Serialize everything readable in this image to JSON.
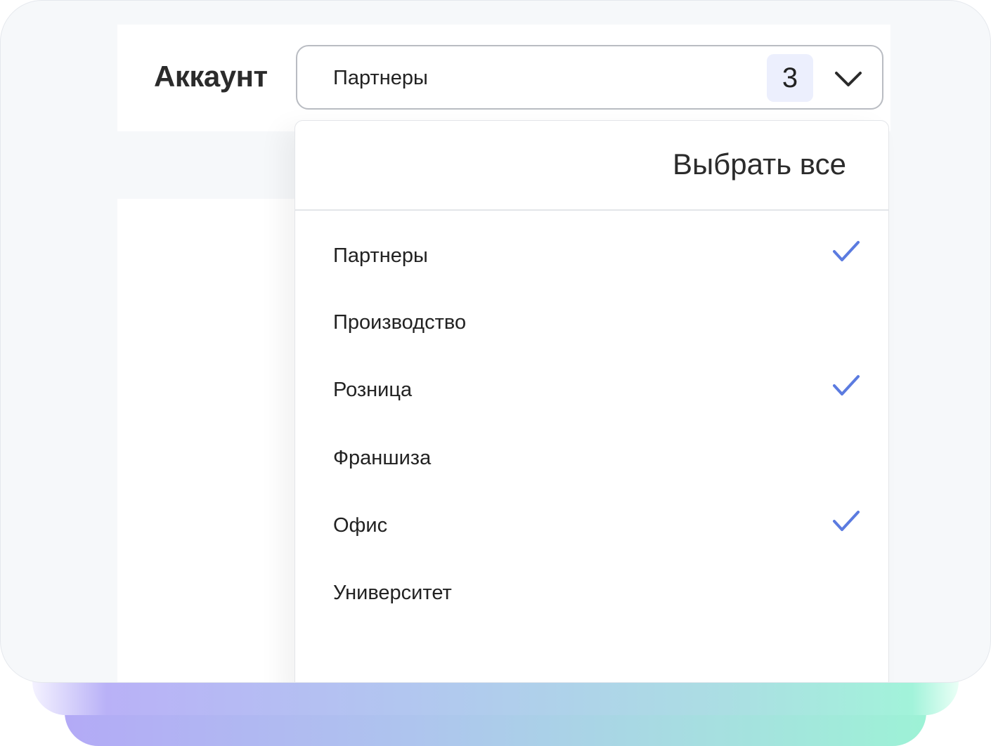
{
  "colors": {
    "accent": "#5b7be0",
    "card_background": "#f6f8fa",
    "badge_background": "#eceffd"
  },
  "header": {
    "label": "Аккаунт"
  },
  "select": {
    "value": "Партнеры",
    "selected_count": "3",
    "icon": "chevron-down-icon"
  },
  "dropdown": {
    "select_all_label": "Выбрать все",
    "options": [
      {
        "label": "Партнеры",
        "checked": true
      },
      {
        "label": "Производство",
        "checked": false
      },
      {
        "label": "Розница",
        "checked": true
      },
      {
        "label": "Франшиза",
        "checked": false
      },
      {
        "label": "Офис",
        "checked": true
      },
      {
        "label": "Университет",
        "checked": false
      }
    ]
  }
}
